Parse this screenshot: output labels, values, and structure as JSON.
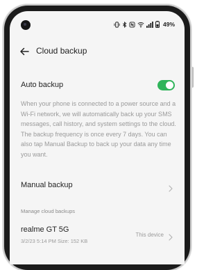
{
  "status_bar": {
    "battery": "49%",
    "icons": [
      "vibrate-icon",
      "bluetooth-icon",
      "nfc-icon",
      "wifi-icon",
      "signal-icon",
      "battery-icon"
    ]
  },
  "header": {
    "title": "Cloud backup",
    "back_icon": "back-arrow-icon"
  },
  "auto_backup": {
    "label": "Auto backup",
    "enabled": true,
    "description": "When your phone is connected to a power source and a Wi-Fi network, we will automatically back up your SMS messages, call history, and system settings to the cloud. The backup frequency is once every 7 days. You can also tap Manual Backup to back up your data any time you want."
  },
  "manual_backup": {
    "label": "Manual backup"
  },
  "cloud_backups": {
    "section_label": "Manage cloud backups",
    "items": [
      {
        "device": "realme GT 5G",
        "meta": "3/2/23 5:14 PM  Size: 152 KB",
        "tag": "This device"
      }
    ]
  },
  "colors": {
    "accent": "#2fb45a",
    "text": "#222222",
    "secondary": "#9a9a9a",
    "background": "#f5f5f5"
  }
}
